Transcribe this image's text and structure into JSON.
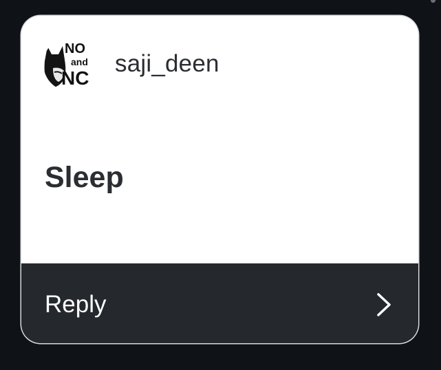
{
  "post": {
    "username": "saji_deen",
    "message": "Sleep",
    "avatar": {
      "description_icon": "batman-avatar-icon",
      "text_lines": [
        "NO",
        "and",
        "NC"
      ]
    }
  },
  "reply": {
    "label": "Reply",
    "icon": "chevron-right-icon"
  },
  "colors": {
    "background": "#0f1317",
    "card": "#ffffff",
    "reply_bar": "#25282d",
    "text_dark": "#2a2d31",
    "text_light": "#ffffff"
  }
}
